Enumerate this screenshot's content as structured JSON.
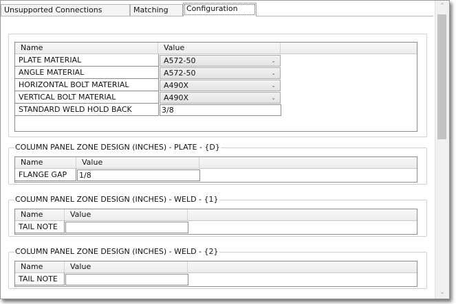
{
  "tabs": [
    {
      "label": "Unsupported Connections"
    },
    {
      "label": "Matching"
    },
    {
      "label": "Configuration"
    }
  ],
  "main_grid": {
    "headers": {
      "name": "Name",
      "value": "Value"
    },
    "rows": [
      {
        "name": "PLATE MATERIAL",
        "value": "A572-50",
        "type": "combo"
      },
      {
        "name": "ANGLE MATERIAL",
        "value": "A572-50",
        "type": "combo"
      },
      {
        "name": "HORIZONTAL BOLT MATERIAL",
        "value": "A490X",
        "type": "combo"
      },
      {
        "name": "VERTICAL BOLT MATERIAL",
        "value": "A490X",
        "type": "combo"
      },
      {
        "name": "STANDARD WELD HOLD BACK",
        "value": "3/8",
        "type": "text"
      }
    ]
  },
  "groups": [
    {
      "title": "COLUMN PANEL ZONE DESIGN (INCHES) - PLATE - {D}",
      "headers": {
        "name": "Name",
        "value": "Value"
      },
      "row": {
        "name": "FLANGE GAP",
        "value": "1/8"
      }
    },
    {
      "title": "COLUMN PANEL ZONE DESIGN (INCHES) - WELD - {1}",
      "headers": {
        "name": "Name",
        "value": "Value"
      },
      "row": {
        "name": "TAIL NOTE",
        "value": ""
      }
    },
    {
      "title": "COLUMN PANEL ZONE DESIGN (INCHES) - WELD - {2}",
      "headers": {
        "name": "Name",
        "value": "Value"
      },
      "row": {
        "name": "TAIL NOTE",
        "value": ""
      }
    }
  ],
  "icons": {
    "dropdown": "chevron-down-icon",
    "scroll_up": "scroll-up-arrow-icon",
    "scroll_down": "scroll-down-arrow-icon"
  }
}
